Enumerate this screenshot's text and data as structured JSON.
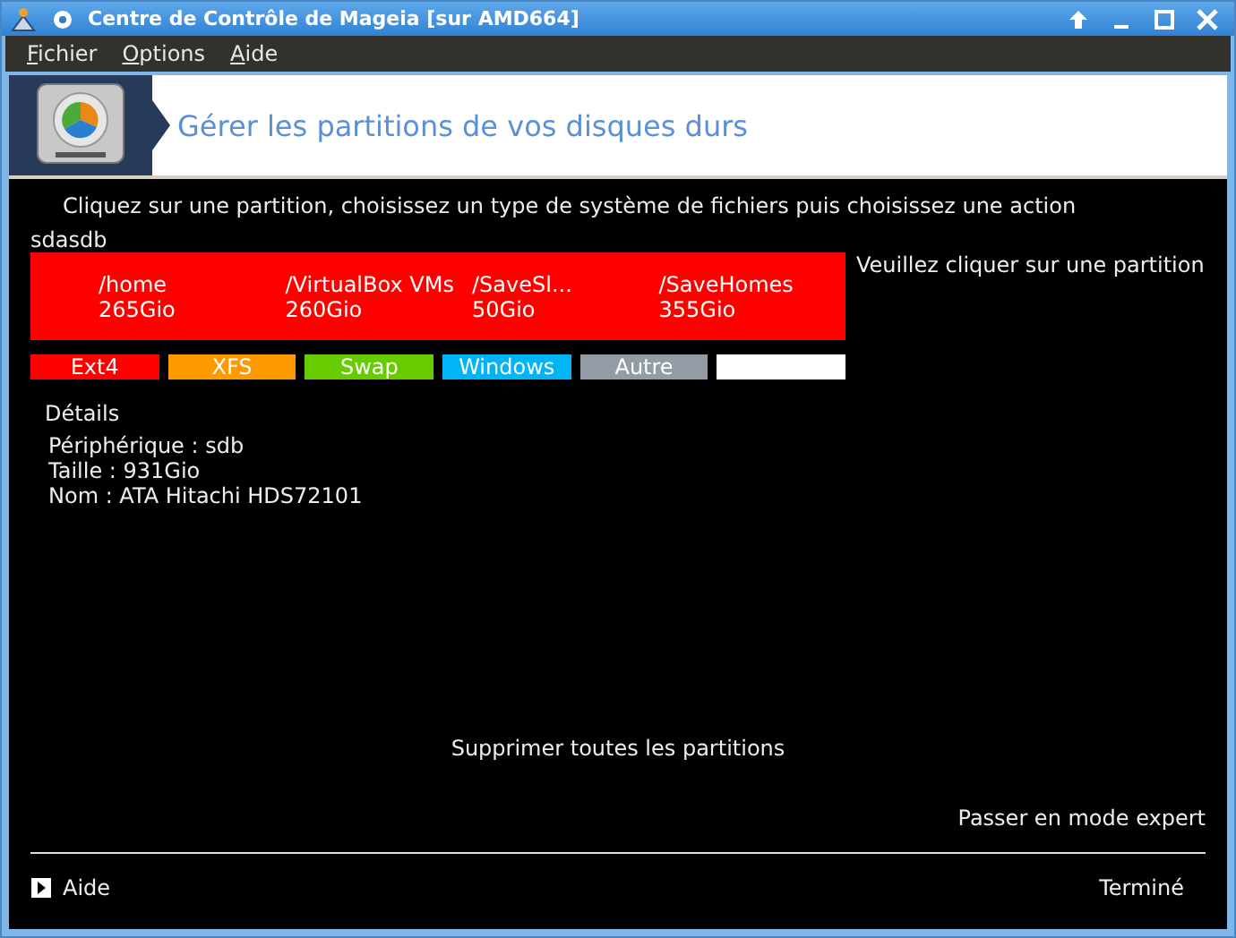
{
  "window": {
    "title": "Centre de Contrôle de Mageia  [sur AMD664]"
  },
  "menu": [
    {
      "mnemonic": "F",
      "rest": "ichier"
    },
    {
      "mnemonic": "O",
      "rest": "ptions"
    },
    {
      "mnemonic": "A",
      "rest": "ide"
    }
  ],
  "header": {
    "title": "Gérer les partitions de vos disques durs"
  },
  "instruction": "Cliquez sur une partition, choisissez un type de système de fichiers puis choisissez une action",
  "disk_tab": "sdasdb",
  "partitions": [
    {
      "name": "/home",
      "size": "265Gio",
      "color": "#ff0000"
    },
    {
      "name": "/VirtualBox VMs",
      "size": "260Gio",
      "color": "#ff0000"
    },
    {
      "name": "/SaveSl...",
      "size": "50Gio",
      "color": "#ff0000"
    },
    {
      "name": "/SaveHomes",
      "size": "355Gio",
      "color": "#ff0000"
    }
  ],
  "hint": "Veuillez cliquer sur une partition",
  "legend": [
    {
      "label": "Ext4",
      "color": "#ff0000"
    },
    {
      "label": "XFS",
      "color": "#ff9900"
    },
    {
      "label": "Swap",
      "color": "#66cc00"
    },
    {
      "label": "Windows",
      "color": "#00b4f5"
    },
    {
      "label": "Autre",
      "color": "#929ba6"
    },
    {
      "color": "#ffffff"
    }
  ],
  "details": {
    "title": "Détails",
    "lines": [
      "Périphérique : sdb",
      "Taille : 931Gio",
      "Nom : ATA Hitachi HDS72101"
    ]
  },
  "delete_all": "Supprimer toutes les partitions",
  "expert": "Passer en mode expert",
  "help": "Aide",
  "done": "Terminé"
}
